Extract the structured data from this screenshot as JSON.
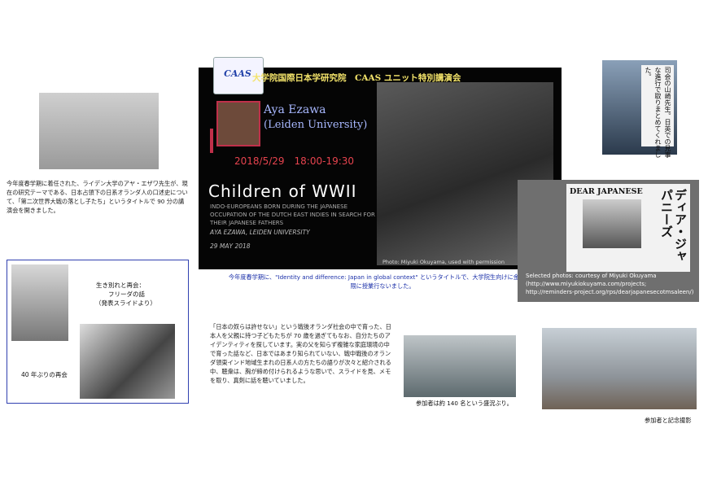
{
  "poster": {
    "logo_text": "CAAS",
    "title_jp": "大学院国際日本学研究院　CAAS ユニット特別講演会",
    "speaker_name": "Aya Ezawa",
    "speaker_affiliation": "(Leiden University)",
    "datetime": "2018/5/29　18:00-19:30",
    "main_title": "Children of WWII",
    "subtitle": "INDO-EUROPEANS BORN DURING THE JAPANESE OCCUPATION OF THE DUTCH EAST INDIES IN SEARCH FOR THEIR JAPANESE FATHERS",
    "author_line": "AYA EZAWA, LEIDEN UNIVERSITY",
    "date_line": "29 MAY 2018",
    "photo_credit": "Photo: Miyuki Okuyama, used with permission",
    "caption": "今年度春学期に、\"Identity and difference: Japan in global context\" というタイトルで、大学院生向けに金曜日 2 限に授業行ないました。"
  },
  "top_left": {
    "caption": "今年度春学期に着任された、ライデン大学のアヤ・エザワ先生が、現在の研究テーマである、日本占領下の日系オランダ人の口述史について、「第二次世界大戦の落とし子たち」というタイトルで 90 分の講演会を開きました。"
  },
  "frame": {
    "line1": "生き別れと再会：",
    "line2": "フリーダの話",
    "line3": "（発表スライドより）",
    "reunion": "40 年ぶりの再会"
  },
  "middle": {
    "text": "「日本の奴らは許せない」という戦後オランダ社会の中で育った、日本人を父親に持つ子どもたちが 70 歳を過ぎてもなお、自分たちのアイデンティティを探しています。実の父を知らず複雑な家庭環境の中で育った話など、日本ではあまり知られていない、戦中戦後のオランダ領東インド地域生まれの日系人の方たちの語りが次々と紹介される中、聴衆は、胸が締め付けられるような思いで、スライドを見、メモを取り、真剣に話を聴いていました。"
  },
  "hall": {
    "caption": "参加者は約 140 名という盛況ぶり。"
  },
  "top_right": {
    "col1": "司会の山崎先生。日英での見事",
    "col2": "な進行で取りまとめてくれまし",
    "col3": "た。"
  },
  "book": {
    "title": "DEAR JAPANESE",
    "title_jp": "ディア・ジャパニーズ",
    "credit1": "Selected photos: courtesy of Miyuki Okuyama",
    "credit2": "(http://www.miyukiokuyama.com/projects;",
    "credit3": "http://reminders-project.org/rps/dearjapanesecotmsaleen/)"
  },
  "group": {
    "caption": "参加者と記念撮影"
  }
}
